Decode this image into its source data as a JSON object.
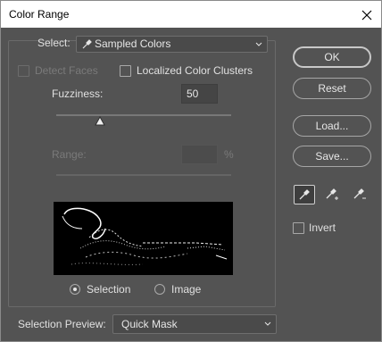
{
  "window": {
    "title": "Color Range"
  },
  "select": {
    "label": "Select:",
    "value": "Sampled Colors"
  },
  "detect_faces": {
    "label": "Detect Faces",
    "checked": false,
    "enabled": false
  },
  "localized": {
    "label": "Localized Color Clusters",
    "checked": false
  },
  "fuzziness": {
    "label": "Fuzziness:",
    "value": "50",
    "slider_fraction": 0.25
  },
  "range": {
    "label": "Range:",
    "value": "",
    "unit": "%",
    "enabled": false
  },
  "preview_mode": {
    "selection_label": "Selection",
    "image_label": "Image",
    "selected": "selection"
  },
  "selection_preview": {
    "label": "Selection Preview:",
    "value": "Quick Mask"
  },
  "buttons": {
    "ok": "OK",
    "reset": "Reset",
    "load": "Load...",
    "save": "Save..."
  },
  "eyedroppers": [
    "eyedropper-icon",
    "eyedropper-plus-icon",
    "eyedropper-minus-icon"
  ],
  "invert": {
    "label": "Invert",
    "checked": false
  },
  "colors": {
    "background": "#535353",
    "titlebar": "#ffffff"
  }
}
